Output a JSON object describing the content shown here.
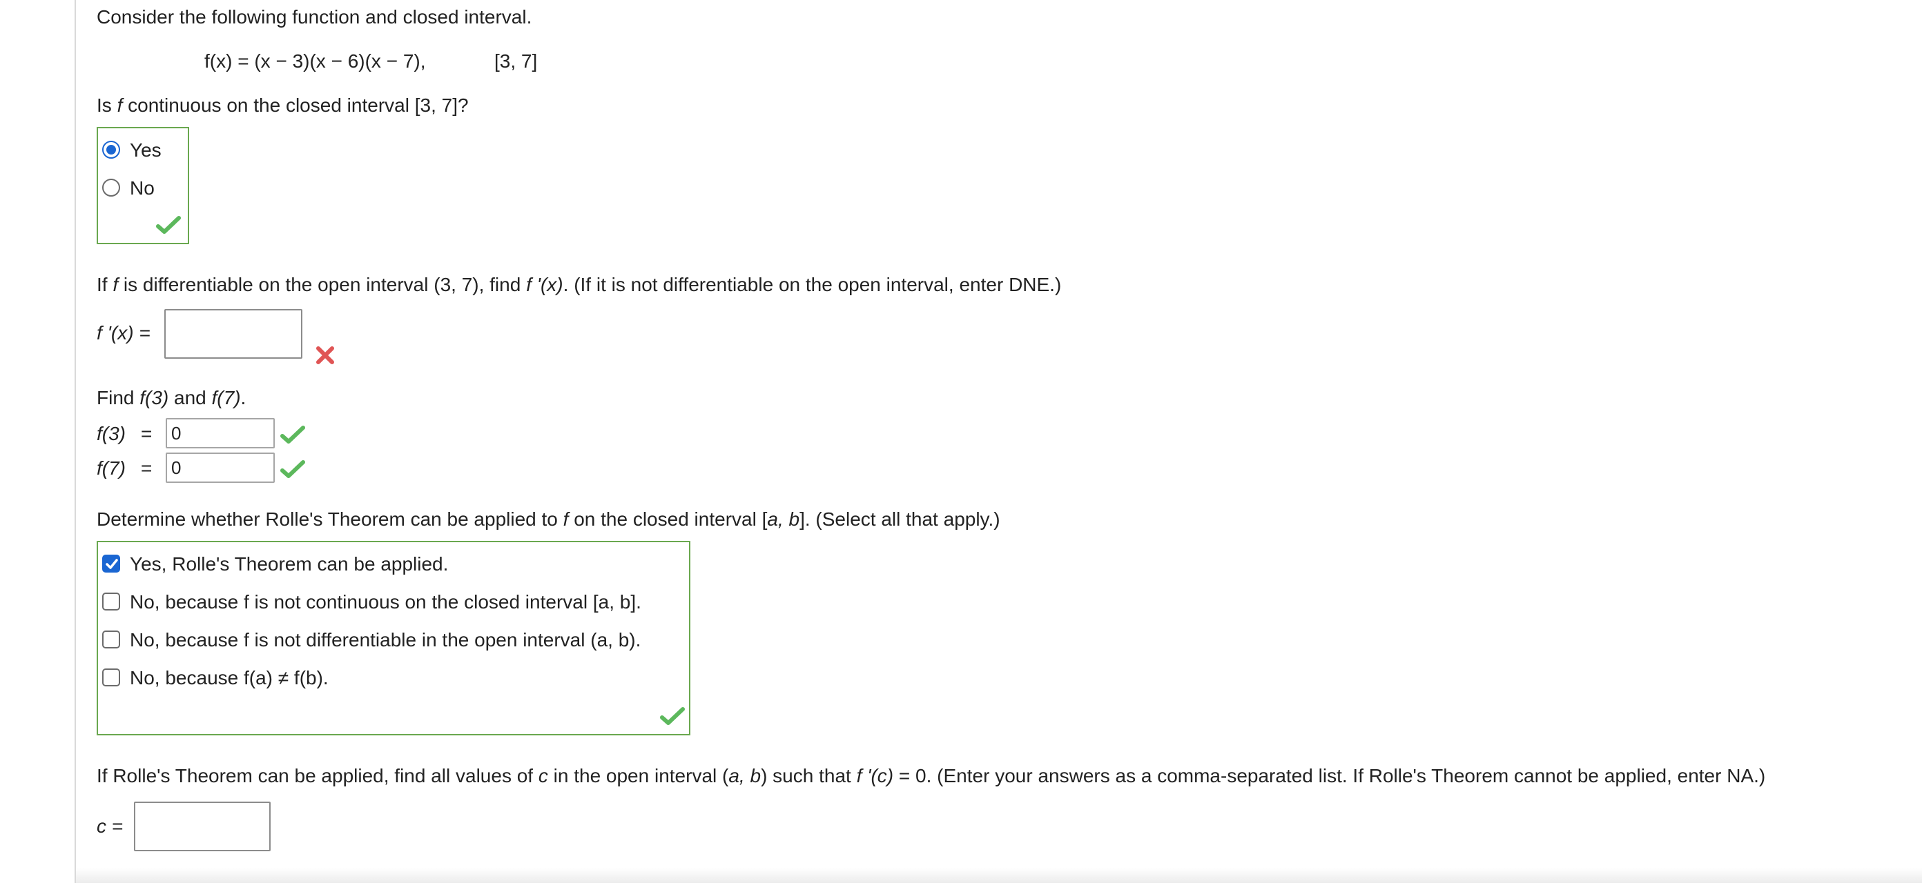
{
  "intro": "Consider the following function and closed interval.",
  "function_def": {
    "lhs": "f(x) = (x − 3)(x − 6)(x − 7),",
    "interval": "[3, 7]"
  },
  "q1": {
    "prompt_a": "Is ",
    "prompt_f": "f",
    "prompt_b": " continuous on the closed interval [3, 7]?",
    "options": [
      {
        "label": "Yes",
        "selected": true
      },
      {
        "label": "No",
        "selected": false
      }
    ],
    "status": "correct"
  },
  "q2": {
    "prompt_a": "If ",
    "prompt_f": "f",
    "prompt_b": " is differentiable on the open interval (3, 7), find ",
    "prompt_fp": "f '(x)",
    "prompt_c": ". (If it is not differentiable on the open interval, enter DNE.)",
    "label": "f '(x) =",
    "value": "",
    "status": "incorrect"
  },
  "q3": {
    "prompt_a": "Find ",
    "prompt_f3": "f(3)",
    "prompt_and": " and ",
    "prompt_f7": "f(7)",
    "prompt_end": ".",
    "rows": [
      {
        "label": "f(3)",
        "eq": "=",
        "value": "0",
        "status": "correct"
      },
      {
        "label": "f(7)",
        "eq": "=",
        "value": "0",
        "status": "correct"
      }
    ]
  },
  "q4": {
    "prompt_a": "Determine whether Rolle's Theorem can be applied to ",
    "prompt_f": "f",
    "prompt_b": " on the closed interval [",
    "prompt_ab": "a, b",
    "prompt_c": "]. (Select all that apply.)",
    "options": [
      {
        "label": "Yes, Rolle's Theorem can be applied.",
        "checked": true
      },
      {
        "label": "No, because f is not continuous on the closed interval [a, b].",
        "checked": false
      },
      {
        "label": "No, because f is not differentiable in the open interval (a, b).",
        "checked": false
      },
      {
        "label": "No, because f(a) ≠ f(b).",
        "checked": false
      }
    ],
    "status": "correct"
  },
  "q5": {
    "prompt_a": "If Rolle's Theorem can be applied, find all values of ",
    "prompt_c_var": "c",
    "prompt_b": " in the open interval (",
    "prompt_ab": "a, b",
    "prompt_c": ") such that ",
    "prompt_fpc": "f '(c)",
    "prompt_d": " = 0. (Enter your answers as a comma-separated list. If Rolle's Theorem cannot be applied, enter NA.)",
    "label": "c =",
    "value": ""
  },
  "colors": {
    "correct": "#5cb85c",
    "incorrect": "#e05555",
    "accent": "#1a66d2",
    "box_border": "#6aa84f"
  }
}
